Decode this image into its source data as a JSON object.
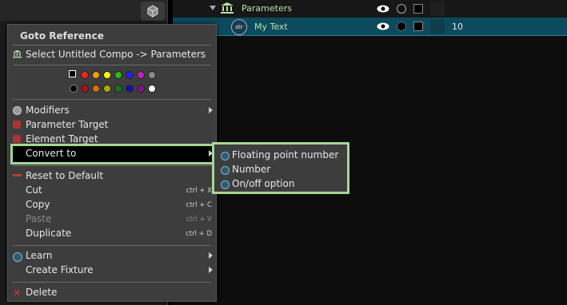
{
  "tree": {
    "rows": [
      {
        "label": "Parameters",
        "value": ""
      },
      {
        "label": "My Text",
        "value": "10",
        "type_badge": "str"
      }
    ]
  },
  "menu": {
    "title": "Goto Reference",
    "goto_item": "Select Untitled Compo -> Parameters",
    "color_swatches_row1": [
      "#000000",
      "#ff2020",
      "#ff9900",
      "#ffff00",
      "#22bb22",
      "#2222ee",
      "#bb22bb",
      "#888888"
    ],
    "color_swatches_row2": [
      "#000000",
      "#aa1111",
      "#cc7700",
      "#aaaa00",
      "#117711",
      "#1111aa",
      "#881188",
      "#ffffff"
    ],
    "items": {
      "modifiers": "Modifiers",
      "parameter_target": "Parameter Target",
      "element_target": "Element Target",
      "convert_to": "Convert to",
      "reset_default": "Reset to Default",
      "cut": "Cut",
      "copy": "Copy",
      "paste": "Paste",
      "duplicate": "Duplicate",
      "learn": "Learn",
      "create_fixture": "Create Fixture",
      "delete": "Delete"
    },
    "shortcuts": {
      "cut": "ctrl + X",
      "copy": "ctrl + C",
      "paste": "ctrl + V",
      "duplicate": "ctrl + D"
    }
  },
  "submenu": {
    "items": [
      "Floating point number",
      "Number",
      "On/off option"
    ]
  },
  "colors": {
    "highlight_outline": "#a6d795",
    "selected_row": "#0c4a5d"
  }
}
